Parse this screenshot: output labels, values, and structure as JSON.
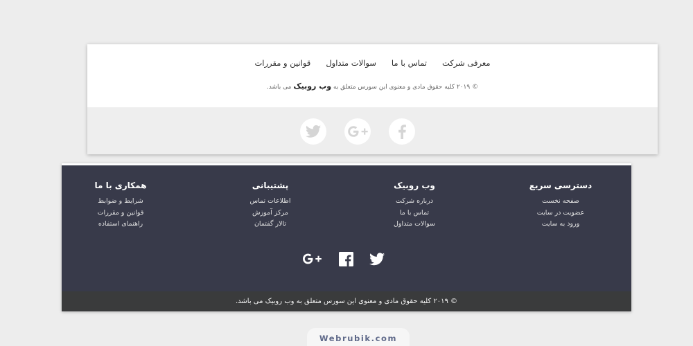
{
  "footer1": {
    "links": [
      "معرفی شرکت",
      "تماس با ما",
      "سوالات متداول",
      "قوانین و مقررات"
    ],
    "copyright_prefix": "© ۲۰۱۹ کلیه حقوق مادی و معنوی این سورس متعلق به",
    "copyright_brand": "وب روبیک",
    "copyright_suffix": "می باشد.",
    "social_icons": [
      "facebook-icon",
      "google-plus-icon",
      "twitter-icon"
    ],
    "colors": {
      "background": "#ffffff",
      "band": "#eeeeee",
      "icon": "#d5d5d5"
    }
  },
  "footer2": {
    "columns": [
      {
        "title": "دسترسی سریع",
        "links": [
          "صفحه نخست",
          "عضویت در سایت",
          "ورود به سایت"
        ]
      },
      {
        "title": "وب روبیک",
        "links": [
          "درباره شرکت",
          "تماس با ما",
          "سوالات متداول"
        ]
      },
      {
        "title": "پشتیبانی",
        "links": [
          "اطلاعات تماس",
          "مرکز آموزش",
          "تالار گفتمان"
        ]
      },
      {
        "title": "همکاری با ما",
        "links": [
          "شرایط و ضوابط",
          "قوانین و مقررات",
          "راهنمای استفاده"
        ]
      }
    ],
    "social_icons": [
      "google-plus-icon",
      "facebook-icon",
      "twitter-icon"
    ],
    "copyright": "© ۲۰۱۹ کلیه حقوق مادی و معنوی این سورس متعلق به وب روبیک می باشد.",
    "colors": {
      "background": "#383a4a",
      "bottom_bar": "#3a3b3c",
      "text": "#ffffff"
    }
  },
  "watermark": "Webrubik.com"
}
